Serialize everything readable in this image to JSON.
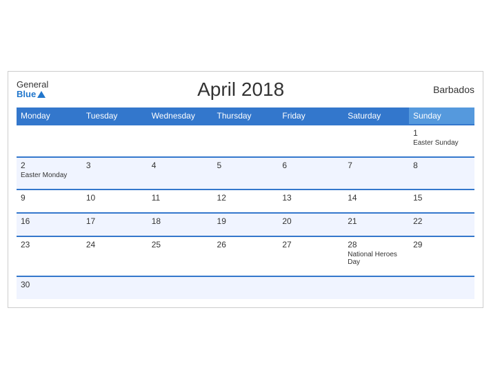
{
  "header": {
    "logo_general": "General",
    "logo_blue": "Blue",
    "title": "April 2018",
    "country": "Barbados"
  },
  "weekdays": [
    "Monday",
    "Tuesday",
    "Wednesday",
    "Thursday",
    "Friday",
    "Saturday",
    "Sunday"
  ],
  "weeks": [
    {
      "days": [
        {
          "number": "",
          "event": ""
        },
        {
          "number": "",
          "event": ""
        },
        {
          "number": "",
          "event": ""
        },
        {
          "number": "",
          "event": ""
        },
        {
          "number": "",
          "event": ""
        },
        {
          "number": "",
          "event": ""
        },
        {
          "number": "1",
          "event": "Easter Sunday"
        }
      ]
    },
    {
      "days": [
        {
          "number": "2",
          "event": "Easter Monday"
        },
        {
          "number": "3",
          "event": ""
        },
        {
          "number": "4",
          "event": ""
        },
        {
          "number": "5",
          "event": ""
        },
        {
          "number": "6",
          "event": ""
        },
        {
          "number": "7",
          "event": ""
        },
        {
          "number": "8",
          "event": ""
        }
      ]
    },
    {
      "days": [
        {
          "number": "9",
          "event": ""
        },
        {
          "number": "10",
          "event": ""
        },
        {
          "number": "11",
          "event": ""
        },
        {
          "number": "12",
          "event": ""
        },
        {
          "number": "13",
          "event": ""
        },
        {
          "number": "14",
          "event": ""
        },
        {
          "number": "15",
          "event": ""
        }
      ]
    },
    {
      "days": [
        {
          "number": "16",
          "event": ""
        },
        {
          "number": "17",
          "event": ""
        },
        {
          "number": "18",
          "event": ""
        },
        {
          "number": "19",
          "event": ""
        },
        {
          "number": "20",
          "event": ""
        },
        {
          "number": "21",
          "event": ""
        },
        {
          "number": "22",
          "event": ""
        }
      ]
    },
    {
      "days": [
        {
          "number": "23",
          "event": ""
        },
        {
          "number": "24",
          "event": ""
        },
        {
          "number": "25",
          "event": ""
        },
        {
          "number": "26",
          "event": ""
        },
        {
          "number": "27",
          "event": ""
        },
        {
          "number": "28",
          "event": "National Heroes Day"
        },
        {
          "number": "29",
          "event": ""
        }
      ]
    },
    {
      "days": [
        {
          "number": "30",
          "event": ""
        },
        {
          "number": "",
          "event": ""
        },
        {
          "number": "",
          "event": ""
        },
        {
          "number": "",
          "event": ""
        },
        {
          "number": "",
          "event": ""
        },
        {
          "number": "",
          "event": ""
        },
        {
          "number": "",
          "event": ""
        }
      ]
    }
  ]
}
